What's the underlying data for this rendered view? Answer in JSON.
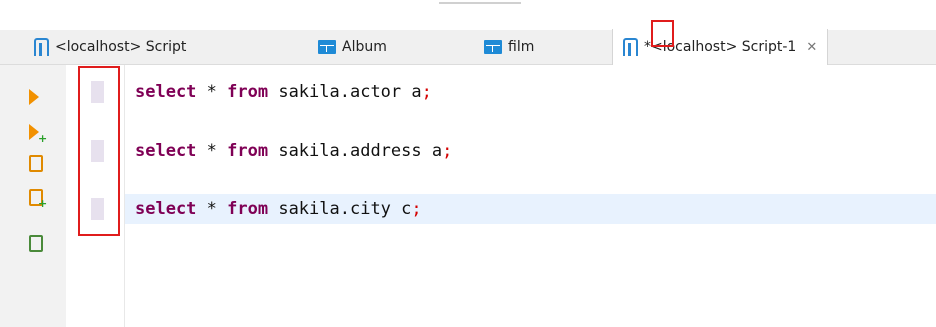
{
  "tabs": [
    {
      "label": "<localhost> Script",
      "icon": "script-icon",
      "active": false
    },
    {
      "label": "Album",
      "icon": "table-icon",
      "active": false
    },
    {
      "label": "film",
      "icon": "table-icon",
      "active": false
    },
    {
      "label": "*<localhost> Script-1",
      "icon": "script-icon",
      "active": true,
      "close_icon": "close-icon"
    }
  ],
  "toolbar": [
    {
      "name": "execute-statement",
      "icon": "play-icon"
    },
    {
      "name": "execute-in-new-tab",
      "icon": "play-plus-icon"
    },
    {
      "name": "execute-script",
      "icon": "script-run-icon"
    },
    {
      "name": "execute-script-new-tab",
      "icon": "script-run-plus-icon"
    },
    {
      "name": "explain-plan",
      "icon": "document-icon"
    }
  ],
  "editor": {
    "lines": [
      {
        "kw1": "select",
        "mid": " * ",
        "kw2": "from",
        "rest": " sakila.actor a",
        "semi": ";"
      },
      {
        "kw1": "select",
        "mid": " * ",
        "kw2": "from",
        "rest": " sakila.address a",
        "semi": ";"
      },
      {
        "kw1": "select",
        "mid": " * ",
        "kw2": "from",
        "rest": " sakila.city c",
        "semi": ";",
        "current": true
      }
    ]
  },
  "colors": {
    "keyword": "#7f0055",
    "semicolon": "#d40000",
    "current_line": "#e8f2fe",
    "highlight_box": "#e01c1c",
    "accent_blue": "#2a86d1"
  }
}
